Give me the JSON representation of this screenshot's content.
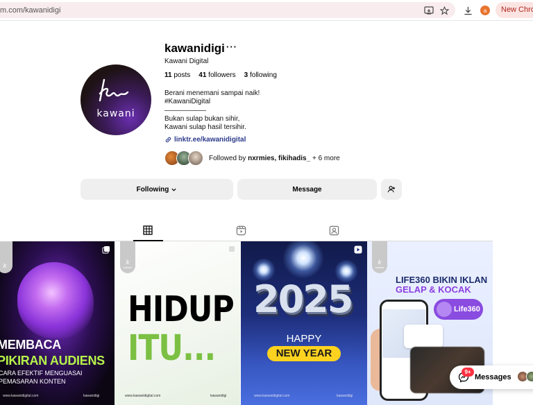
{
  "browser": {
    "url": "m.com/kawanidigi",
    "profile_initial": "a",
    "new_chrome_label": "New Chrom"
  },
  "profile": {
    "username": "kawanidigi",
    "more": "···",
    "full_name": "Kawani Digital",
    "avatar_word": "kawani",
    "stats": {
      "posts_count": "11",
      "posts_label": "posts",
      "followers_count": "41",
      "followers_label": "followers",
      "following_count": "3",
      "following_label": "following"
    },
    "bio": [
      "Berani menemani sampai naik!",
      "#KawaniDigital",
      "——————",
      "Bukan sulap bukan sihir,",
      "Kawani sulap hasil tersihir."
    ],
    "link": "linktr.ee/kawanidigital",
    "followed_by_prefix": "Followed by",
    "followed_by_names": "nxrmies, fikihadis_",
    "followed_by_suffix": "+ 6 more"
  },
  "actions": {
    "following_label": "Following",
    "message_label": "Message"
  },
  "posts": {
    "post1": {
      "title1": "MEMBACA",
      "title2": "PIKIRAN AUDIENS",
      "sub1": "CARA EFEKTIF MENGUASAI",
      "sub2": "PEMASARAN KONTEN",
      "footer_left": "www.kawanidigital.com",
      "footer_right": "kawanidigi"
    },
    "post2": {
      "title1": "HIDUP",
      "title2": "ITU...",
      "footer_left": "www.kawanidigital.com",
      "footer_right": "kawanidigi"
    },
    "post3": {
      "year": "2025",
      "happy": "HAPPY",
      "new_year": "NEW YEAR",
      "footer_left": "www.kawanidigital.com",
      "footer_right": "kawanidigi"
    },
    "post4": {
      "title1": "LIFE360 BIKIN IKLAN",
      "title2": "GELAP & KOCAK",
      "brand": "Life360"
    },
    "tag_small": "kawani"
  },
  "messages": {
    "badge": "9+",
    "label": "Messages"
  },
  "colors": {
    "link": "#2b3a8a",
    "button_bg": "#efefef",
    "badge": "#ff3040",
    "accent_green": "#7bc043",
    "accent_purple": "#8a4be0",
    "new_year_yellow": "#ffd21f"
  },
  "icons": [
    "cast-icon",
    "star-icon",
    "download-icon",
    "link-icon",
    "chevron-down-icon",
    "add-user-icon",
    "grid-icon",
    "reels-icon",
    "tagged-icon",
    "carousel-icon",
    "reel-icon",
    "messenger-icon"
  ]
}
